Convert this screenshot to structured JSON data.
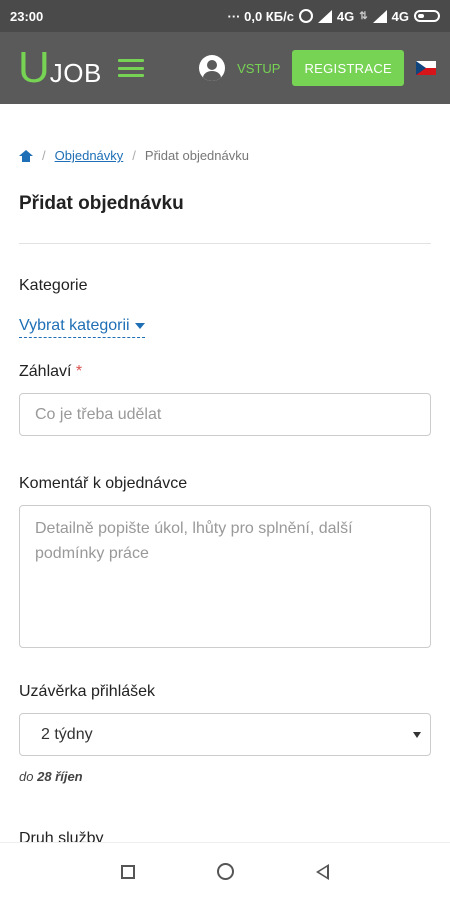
{
  "status_bar": {
    "time": "23:00",
    "network_speed": "··· 0,0 КБ/с",
    "net_label_1": "4G",
    "net_label_2": "4G"
  },
  "header": {
    "logo_u": "U",
    "logo_job": "JOB",
    "login_label": "VSTUP",
    "register_label": "REGISTRACE"
  },
  "breadcrumb": {
    "link_label": "Objednávky",
    "current_label": "Přidat objednávku",
    "separator": "/"
  },
  "page": {
    "title": "Přidat objednávku"
  },
  "form": {
    "category_label": "Kategorie",
    "category_select": "Vybrat kategorii",
    "title_label": "Záhlaví",
    "required_mark": "*",
    "title_placeholder": "Co je třeba udělat",
    "comment_label": "Komentář k objednávce",
    "comment_placeholder": "Detailně popište úkol, lhůty pro splnění, další podmínky práce",
    "deadline_label": "Uzávěrka přihlášek",
    "deadline_value": "2 týdny",
    "deadline_note_prefix": "do",
    "deadline_note_date": "28 říjen",
    "service_label": "Druh služby"
  },
  "colors": {
    "accent_green": "#77d354",
    "link_blue": "#1e6fb5",
    "header_gray": "#5a5a5a",
    "statusbar_gray": "#4a4a4a"
  },
  "icons": [
    "alarm-icon",
    "signal-icon",
    "battery-icon",
    "user-icon",
    "menu-icon",
    "flag-cz-icon",
    "home-icon",
    "caret-down-icon",
    "nav-recent-icon",
    "nav-home-icon",
    "nav-back-icon"
  ]
}
